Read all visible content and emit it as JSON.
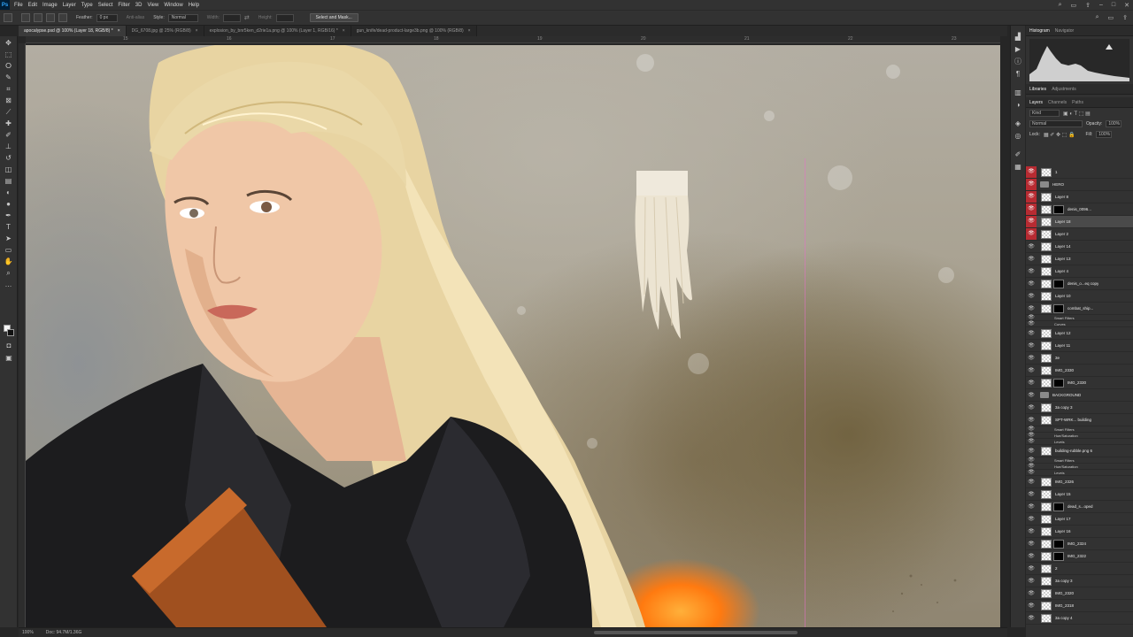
{
  "app": {
    "logo": "Ps"
  },
  "menu": [
    "File",
    "Edit",
    "Image",
    "Layer",
    "Type",
    "Select",
    "Filter",
    "3D",
    "View",
    "Window",
    "Help"
  ],
  "options": {
    "feather_label": "Feather:",
    "feather_value": "0 px",
    "antialias_label": "Anti-alias",
    "style_label": "Style:",
    "style_value": "Normal",
    "width_label": "Width:",
    "height_label": "Height:",
    "select_mask_label": "Select and Mask..."
  },
  "tabs": [
    "apocalypse.psd @ 100% (Layer 18, RGB/8) *",
    "DG_6708.jpg @ 25% (RGB/8)",
    "explosion_by_bnr5ken_d2rie1a.png @ 100% (Layer 1, RGB/16) *",
    "gun_knife/dead-product-large3b.png @ 100% (RGB/8)"
  ],
  "ruler_marks": [
    "15",
    "16",
    "17",
    "18",
    "19",
    "20",
    "21",
    "22",
    "23",
    "24"
  ],
  "panels": {
    "top_tabs": [
      "Histogram",
      "Navigator"
    ],
    "mid_tabs": [
      "Libraries",
      "Adjustments"
    ],
    "layer_tabs": [
      "Layers",
      "Channels",
      "Paths"
    ],
    "kind_label": "Kind",
    "blend_mode": "Normal",
    "opacity_label": "Opacity:",
    "opacity_value": "100%",
    "lock_label": "Lock:",
    "fill_label": "Fill:",
    "fill_value": "100%"
  },
  "layers": [
    {
      "name": "1",
      "type": "layer",
      "red": true
    },
    {
      "name": "HERO",
      "type": "group",
      "red": true
    },
    {
      "name": "Layer 8",
      "type": "layer",
      "red": true
    },
    {
      "name": "denis_0096...",
      "type": "layer",
      "red": true,
      "mask": true
    },
    {
      "name": "Layer 18",
      "type": "layer",
      "red": true,
      "selected": true
    },
    {
      "name": "Layer 2",
      "type": "layer",
      "red": true
    },
    {
      "name": "Layer 14",
      "type": "layer"
    },
    {
      "name": "Layer 13",
      "type": "layer"
    },
    {
      "name": "Layer 4",
      "type": "layer"
    },
    {
      "name": "denis_o...eq copy",
      "type": "layer",
      "mask": true
    },
    {
      "name": "Layer 10",
      "type": "layer"
    },
    {
      "name": "combat_ship...",
      "type": "layer",
      "mask": true
    },
    {
      "name": "Smart Filters",
      "type": "sub"
    },
    {
      "name": "Curves",
      "type": "sub"
    },
    {
      "name": "Layer 12",
      "type": "layer"
    },
    {
      "name": "Layer 11",
      "type": "layer"
    },
    {
      "name": "3e",
      "type": "layer"
    },
    {
      "name": "IMG_2330",
      "type": "layer"
    },
    {
      "name": "IMG_2330",
      "type": "layer",
      "mask": true
    },
    {
      "name": "BACKGROUND",
      "type": "group"
    },
    {
      "name": "3a copy 3",
      "type": "layer"
    },
    {
      "name": "SPT-WRK... building",
      "type": "layer"
    },
    {
      "name": "Smart Filters",
      "type": "sub"
    },
    {
      "name": "Hue/Saturation",
      "type": "sub"
    },
    {
      "name": "Levels",
      "type": "sub"
    },
    {
      "name": "building-rubble.png 6",
      "type": "layer"
    },
    {
      "name": "Smart Filters",
      "type": "sub"
    },
    {
      "name": "Hue/Saturation",
      "type": "sub"
    },
    {
      "name": "Levels",
      "type": "sub"
    },
    {
      "name": "IMG_2326",
      "type": "layer"
    },
    {
      "name": "Layer 15",
      "type": "layer"
    },
    {
      "name": "dead_s...oped",
      "type": "layer",
      "mask": true
    },
    {
      "name": "Layer 17",
      "type": "layer"
    },
    {
      "name": "Layer 16",
      "type": "layer"
    },
    {
      "name": "IMG_2324",
      "type": "layer",
      "mask": true
    },
    {
      "name": "IMG_2322",
      "type": "layer",
      "mask": true
    },
    {
      "name": "2",
      "type": "layer"
    },
    {
      "name": "3a copy 3",
      "type": "layer"
    },
    {
      "name": "IMG_2320",
      "type": "layer"
    },
    {
      "name": "IMG_2318",
      "type": "layer"
    },
    {
      "name": "3a copy 4",
      "type": "layer"
    }
  ],
  "status": {
    "zoom": "100%",
    "doc": "Doc: 94.7M/1.36G"
  }
}
